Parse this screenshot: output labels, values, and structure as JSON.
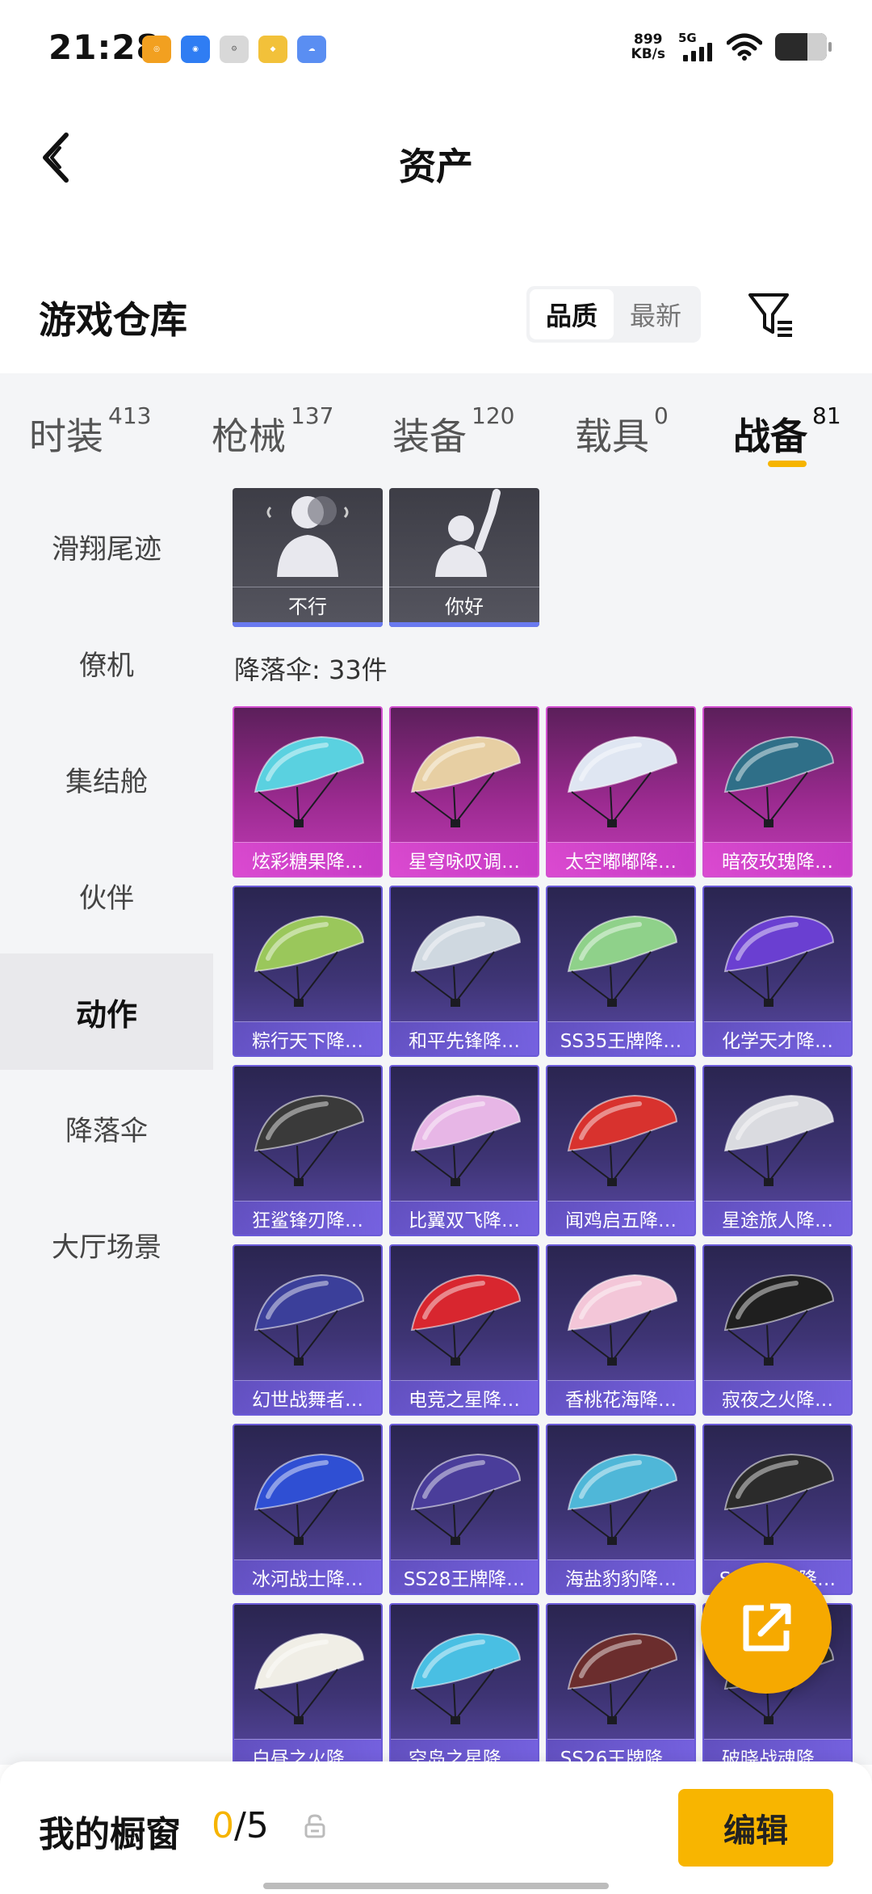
{
  "status_bar": {
    "time": "21:28",
    "speed_value": "899",
    "speed_unit": "KB/s",
    "network": "5G",
    "app_icons": [
      "app-icon-1",
      "app-icon-2",
      "app-icon-3",
      "app-icon-4",
      "app-icon-5"
    ]
  },
  "header": {
    "title": "资产"
  },
  "section": {
    "title": "游戏仓库",
    "sort_options": [
      {
        "label": "品质",
        "active": true
      },
      {
        "label": "最新",
        "active": false
      }
    ]
  },
  "category_tabs": [
    {
      "name": "时装",
      "count": "413",
      "active": false
    },
    {
      "name": "枪械",
      "count": "137",
      "active": false
    },
    {
      "name": "装备",
      "count": "120",
      "active": false
    },
    {
      "name": "载具",
      "count": "0",
      "active": false
    },
    {
      "name": "战备",
      "count": "81",
      "active": true
    }
  ],
  "sidebar": {
    "items": [
      {
        "label": "滑翔尾迹",
        "active": false
      },
      {
        "label": "僚机",
        "active": false
      },
      {
        "label": "集结舱",
        "active": false
      },
      {
        "label": "伙伴",
        "active": false
      },
      {
        "label": "动作",
        "active": true
      },
      {
        "label": "降落伞",
        "active": false
      },
      {
        "label": "大厅场景",
        "active": false
      }
    ]
  },
  "emotes": [
    {
      "label": "不行"
    },
    {
      "label": "你好"
    }
  ],
  "parachutes": {
    "count_label": "降落伞: 33件",
    "items": [
      {
        "name": "炫彩糖果降…",
        "rarity": "legend",
        "color": "#5ad1e0"
      },
      {
        "name": "星穹咏叹调…",
        "rarity": "legend",
        "color": "#e7cfa3"
      },
      {
        "name": "太空嘟嘟降…",
        "rarity": "legend",
        "color": "#dfe6f2"
      },
      {
        "name": "暗夜玫瑰降…",
        "rarity": "legend",
        "color": "#2f6f88"
      },
      {
        "name": "粽行天下降…",
        "rarity": "epic",
        "color": "#9ac75b"
      },
      {
        "name": "和平先锋降…",
        "rarity": "epic",
        "color": "#cfd8e0"
      },
      {
        "name": "SS35王牌降…",
        "rarity": "epic",
        "color": "#8fd18a"
      },
      {
        "name": "化学天才降…",
        "rarity": "epic",
        "color": "#6a3fd1"
      },
      {
        "name": "狂鲨锋刃降…",
        "rarity": "epic",
        "color": "#3a3a3a"
      },
      {
        "name": "比翼双飞降…",
        "rarity": "epic",
        "color": "#e7b6e6"
      },
      {
        "name": "闻鸡启五降…",
        "rarity": "epic",
        "color": "#d8322e"
      },
      {
        "name": "星途旅人降…",
        "rarity": "epic",
        "color": "#dadbe0"
      },
      {
        "name": "幻世战舞者…",
        "rarity": "epic",
        "color": "#3b3f9a"
      },
      {
        "name": "电竞之星降…",
        "rarity": "epic",
        "color": "#d8262f"
      },
      {
        "name": "香桃花海降…",
        "rarity": "epic",
        "color": "#f3c6d8"
      },
      {
        "name": "寂夜之火降…",
        "rarity": "epic",
        "color": "#1f1f1f"
      },
      {
        "name": "冰河战士降…",
        "rarity": "epic",
        "color": "#2f4fd3"
      },
      {
        "name": "SS28王牌降…",
        "rarity": "epic",
        "color": "#4a3d9a"
      },
      {
        "name": "海盐豹豹降…",
        "rarity": "epic",
        "color": "#4fb7d8"
      },
      {
        "name": "SS…王牌降…",
        "rarity": "epic",
        "color": "#2b2b2b"
      },
      {
        "name": "白昼之火降…",
        "rarity": "epic",
        "color": "#f0eee6"
      },
      {
        "name": "空岛之星降…",
        "rarity": "epic",
        "color": "#49bfe3"
      },
      {
        "name": "SS26王牌降…",
        "rarity": "epic",
        "color": "#6b2d2d"
      },
      {
        "name": "破晓战魂降…",
        "rarity": "epic",
        "color": "#2a2a2a"
      }
    ]
  },
  "showcase": {
    "title": "我的橱窗",
    "current": "0",
    "total": "/5",
    "edit_label": "编辑"
  },
  "accent_color": "#f6b400"
}
